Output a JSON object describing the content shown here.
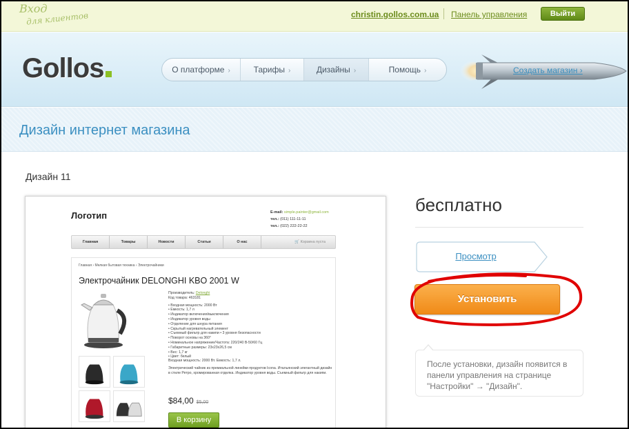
{
  "topbar": {
    "login_logo_line1": "Вход",
    "login_logo_line2": "для клиентов",
    "domain": "christin.gollos.com.ua",
    "panel_link": "Панель управления",
    "logout": "Выйти"
  },
  "header": {
    "brand": "Gollos",
    "nav": [
      {
        "label": "О платформе",
        "icon": "chevron-right"
      },
      {
        "label": "Тарифы",
        "icon": "chevron-right"
      },
      {
        "label": "Дизайны",
        "icon": "chevron-right",
        "active": true
      },
      {
        "label": "Помощь",
        "icon": "chevron-right"
      }
    ],
    "create_store": "Создать магазин ›",
    "accent_color": "#8cc024"
  },
  "page": {
    "title": "Дизайн интернет магазина",
    "design_name": "Дизайн 11"
  },
  "preview": {
    "logo": "Логотип",
    "email_label": "E-mail:",
    "email": "simple.painter@gmail.com",
    "phone1_label": "тел.:",
    "phone1": "(011) 111-11-11",
    "phone2_label": "тел.:",
    "phone2": "(022) 222-22-22",
    "menu": [
      "Главная",
      "Товары",
      "Новости",
      "Статьи",
      "О нас"
    ],
    "cart": "Корзина пуста",
    "breadcrumb": "Главная › Мелкая бытовая техника › Электрочайники",
    "product_title": "Электрочайник DELONGHI KBO 2001 W",
    "manufacturer_label": "Производитель:",
    "manufacturer": "Delonghi",
    "sku": "Код товара: 463181",
    "specs": [
      "• Входная мощность: 2000 Вт",
      "• Емкость: 1,7 л",
      "• Индикатор включения/выключения",
      "• Индикатор уровня воды",
      "• Отделение для шнура питания",
      "• Скрытый нагревательный элемент",
      "• Съемный фильтр для накипи • 3 уровня безопасности",
      "• Поворот основы на 360°",
      "• Номинальное напряжение/Частота: 220/240 В-50/60 Гц",
      "• Габаритные размеры: 23х23х26,5 см",
      "• Вес: 1,7 кг",
      "• Цвет: белый"
    ],
    "desc1": "Входная мощность: 2000 Вт. Емкость: 1,7 л.",
    "desc2": "Электрический чайник из премиальной линейки продуктов Icona. Итальянский элегантный дизайн в стиле Ретро, хромированная отделка. Индикатор уровня воды. Съемный фильтр для накипи.",
    "price": "$84,00",
    "old_price": "$5,00",
    "cart_button": "В корзину"
  },
  "sidebar": {
    "price_label": "бесплатно",
    "view_button": "Просмотр",
    "install_button": "Установить",
    "note": "После установки, дизайн появится в панели управления на странице \"Настройки\" → \"Дизайн\".",
    "install_color": "#f39a25",
    "highlight_color": "#e00000"
  }
}
